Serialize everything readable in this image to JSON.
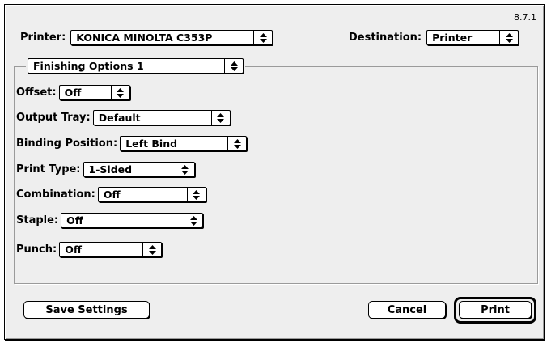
{
  "version": "8.7.1",
  "printer": {
    "label": "Printer:",
    "value": "KONICA MINOLTA C353P"
  },
  "destination": {
    "label": "Destination:",
    "value": "Printer"
  },
  "panel": {
    "value": "Finishing Options 1"
  },
  "options": [
    {
      "label": "Offset:",
      "value": "Off"
    },
    {
      "label": "Output Tray:",
      "value": "Default"
    },
    {
      "label": "Binding Position:",
      "value": "Left Bind"
    },
    {
      "label": "Print Type:",
      "value": "1-Sided"
    },
    {
      "label": "Combination:",
      "value": "Off"
    },
    {
      "label": "Staple:",
      "value": "Off"
    },
    {
      "label": "Punch:",
      "value": "Off"
    }
  ],
  "buttons": {
    "save_settings": "Save Settings",
    "cancel": "Cancel",
    "print": "Print"
  },
  "icons": {
    "popup_arrow": "up-down-arrows-icon"
  }
}
